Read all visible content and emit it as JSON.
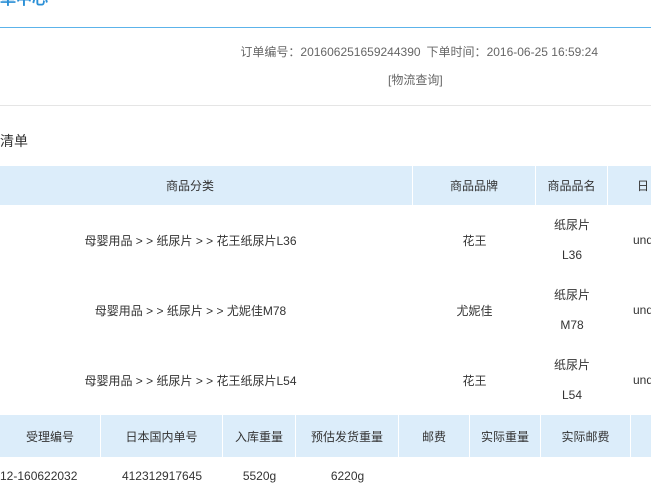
{
  "header": {
    "title": "单中心"
  },
  "order": {
    "number_label": "订单编号：",
    "number": "201606251659244390",
    "time_label": "下单时间：",
    "time": "2016-06-25 16:59:24",
    "logistics_link": "[物流查询]"
  },
  "items": {
    "title": "清单",
    "columns": [
      "商品分类",
      "商品品牌",
      "商品品名",
      "日"
    ],
    "rows": [
      {
        "category": "母婴用品 > > 纸尿片 > > 花王纸尿片L36",
        "brand": "花王",
        "name_lines": [
          "纸尿片",
          "L36"
        ],
        "jp_name": "und"
      },
      {
        "category": "母婴用品 > > 纸尿片 > > 尤妮佳M78",
        "brand": "尤妮佳",
        "name_lines": [
          "纸尿片",
          "M78"
        ],
        "jp_name": "und"
      },
      {
        "category": "母婴用品 > > 纸尿片 > > 花王纸尿片L54",
        "brand": "花王",
        "name_lines": [
          "纸尿片",
          "L54"
        ],
        "jp_name": "und"
      }
    ]
  },
  "shipping": {
    "columns": [
      "受理编号",
      "日本国内单号",
      "入库重量",
      "预估发货重量",
      "邮费",
      "实际重量",
      "实际邮费"
    ],
    "rows": [
      {
        "accept_no": "12-160622032",
        "jp_tracking_no": "412312917645",
        "inbound_weight": "5520g",
        "est_ship_weight": "6220g"
      }
    ]
  },
  "colors": {
    "accent": "#2b8fd6",
    "rule": "#5cb3ea",
    "table_header_bg": "#dcedfa",
    "text": "#333333",
    "muted_text": "#666666"
  }
}
